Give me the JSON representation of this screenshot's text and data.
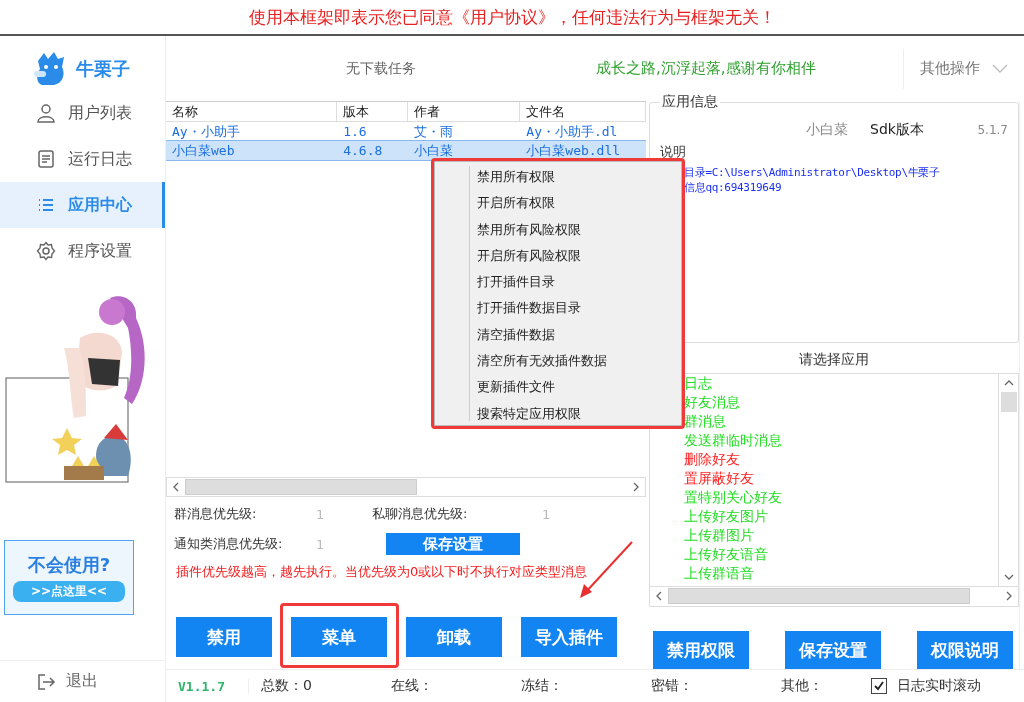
{
  "banner": {
    "text": "使用本框架即表示您已同意《用户协议》，任何违法行为与框架无关！"
  },
  "brand": {
    "name": "牛栗子"
  },
  "nav": [
    {
      "label": "用户列表",
      "kind": "user",
      "selected": false
    },
    {
      "label": "运行日志",
      "kind": "log",
      "selected": false
    },
    {
      "label": "应用中心",
      "kind": "list",
      "selected": true
    },
    {
      "label": "程序设置",
      "kind": "gear",
      "selected": false
    }
  ],
  "help_card": {
    "title": "不会使用?",
    "button": ">>点这里<<"
  },
  "exit": {
    "label": "退出"
  },
  "header": {
    "download_status": "无下载任务",
    "slogan": "成长之路,沉浮起落,感谢有你相伴",
    "other_ops": "其他操作"
  },
  "table": {
    "columns": [
      "名称",
      "版本",
      "作者",
      "文件名"
    ],
    "rows": [
      {
        "cells": [
          "Ay・小助手",
          "1.6",
          "艾・雨",
          "Ay・小助手.dl"
        ],
        "selected": false
      },
      {
        "cells": [
          "小白菜web",
          "4.6.8",
          "小白菜",
          "小白菜web.dll"
        ],
        "selected": true
      }
    ]
  },
  "context_menu": {
    "items": [
      "禁用所有权限",
      "开启所有权限",
      "禁用所有风险权限",
      "开启所有风险权限",
      "打开插件目录",
      "打开插件数据目录",
      "清空插件数据",
      "清空所有无效插件数据",
      "更新插件文件",
      "搜索特定应用权限"
    ]
  },
  "priorities": [
    {
      "label": "群消息优先级:",
      "value": "1"
    },
    {
      "label": "私聊消息优先级:",
      "value": "1"
    },
    {
      "label": "通知类消息优先级:",
      "value": "1"
    }
  ],
  "priority_save": "保存设置",
  "note": "插件优先级越高，越先执行。当优先级为0或以下时不执行对应类型消息",
  "buttons": [
    "禁用",
    "菜单",
    "卸载",
    "导入插件"
  ],
  "app_info": {
    "title": "应用信息",
    "app_name": "小白菜",
    "sdk_label": "Sdk版本",
    "sdk_version": "5.1.7",
    "desc_label": "说明",
    "desc_lines": [
      "目录=C:\\Users\\Administrator\\Desktop\\牛栗子",
      "信息qq:694319649"
    ]
  },
  "permissions": {
    "title": "请选择应用",
    "items": [
      {
        "label": "日志",
        "color": "#22dd22"
      },
      {
        "label": "好友消息",
        "color": "#22dd22"
      },
      {
        "label": "群消息",
        "color": "#22dd22"
      },
      {
        "label": "发送群临时消息",
        "color": "#22dd22"
      },
      {
        "label": "删除好友",
        "color": "#ff2222"
      },
      {
        "label": "置屏蔽好友",
        "color": "#ff2222"
      },
      {
        "label": "置特别关心好友",
        "color": "#22dd22"
      },
      {
        "label": "上传好友图片",
        "color": "#22dd22"
      },
      {
        "label": "上传群图片",
        "color": "#22dd22"
      },
      {
        "label": "上传好友语音",
        "color": "#22dd22"
      },
      {
        "label": "上传群语音",
        "color": "#22dd22"
      }
    ],
    "buttons": [
      "禁用权限",
      "保存设置",
      "权限说明"
    ]
  },
  "status": {
    "version": "V1.1.7",
    "stats": [
      "总数：0",
      "在线：",
      "冻结：",
      "密错：",
      "其他："
    ],
    "log_scroll": {
      "label": "日志实时滚动",
      "checked": true
    }
  }
}
